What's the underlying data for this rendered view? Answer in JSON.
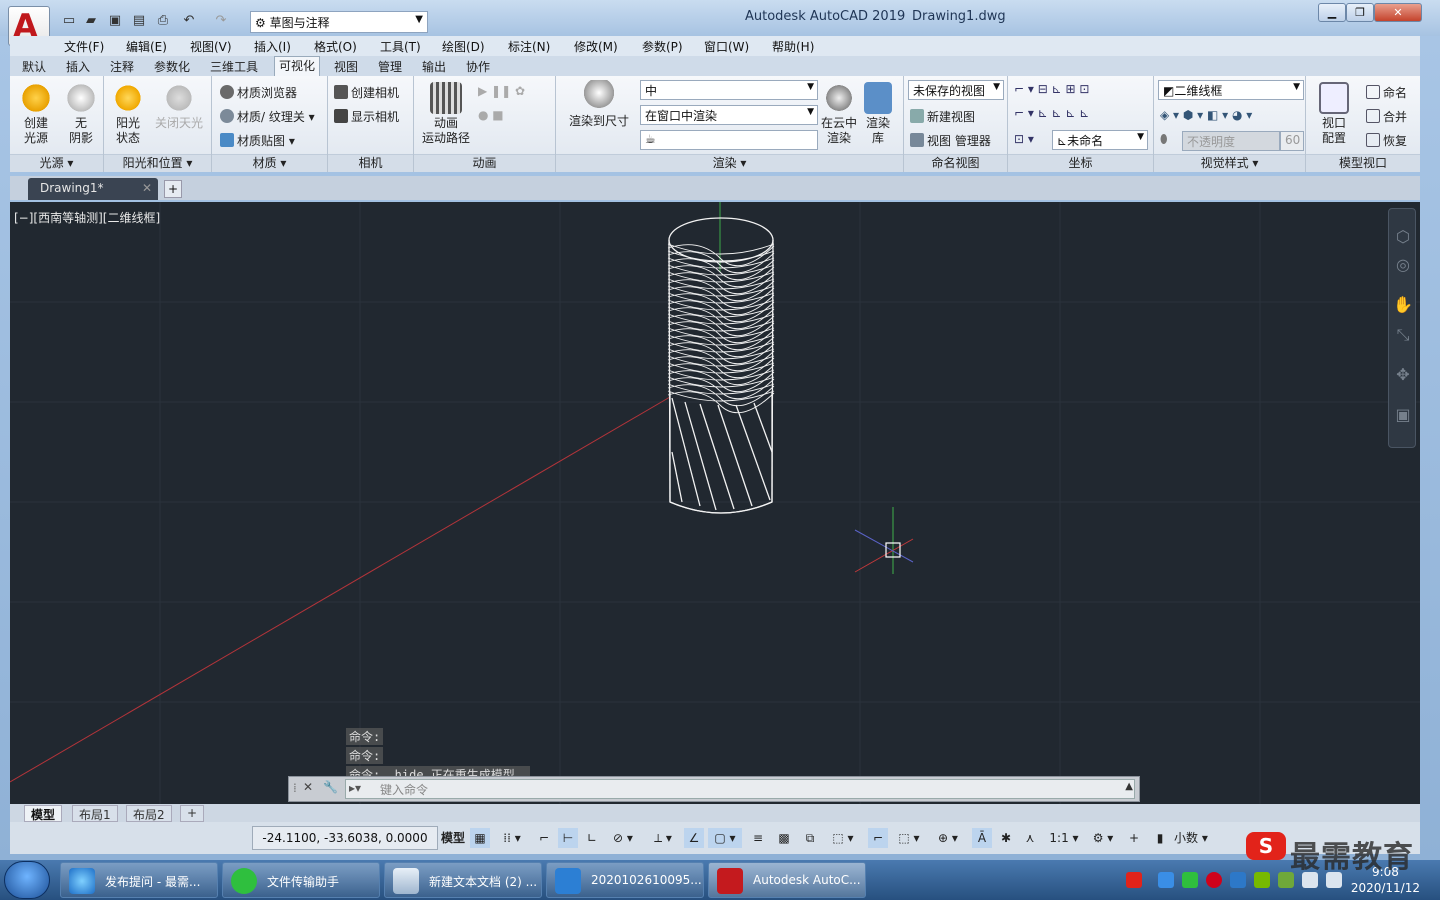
{
  "app": {
    "title": "Autodesk AutoCAD 2019",
    "document": "Drawing1.dwg",
    "workspace": "草图与注释",
    "menu_symbol": "A"
  },
  "menus": [
    "文件(F)",
    "编辑(E)",
    "视图(V)",
    "插入(I)",
    "格式(O)",
    "工具(T)",
    "绘图(D)",
    "标注(N)",
    "修改(M)",
    "参数(P)",
    "窗口(W)",
    "帮助(H)"
  ],
  "ribbon_tabs": [
    "默认",
    "插入",
    "注释",
    "参数化",
    "三维工具",
    "可视化",
    "视图",
    "管理",
    "输出",
    "协作"
  ],
  "active_tab": "可视化",
  "ribbon": {
    "lights": {
      "create_light": "创建\n光源",
      "no_shadow": "无\n阴影",
      "title": "光源"
    },
    "sun": {
      "sun_status": "阳光\n状态",
      "off_sky": "关闭天光",
      "title": "阳光和位置"
    },
    "materials": {
      "browser": "材质浏览器",
      "texture": "材质/ 纹理关",
      "mapping": "材质贴图",
      "title": "材质"
    },
    "camera": {
      "create": "创建相机",
      "show": "显示相机",
      "title": "相机"
    },
    "animation": {
      "motion_path": "动画\n运动路径",
      "title": "动画"
    },
    "render": {
      "render_size": "渲染到尺寸",
      "quality": "中",
      "target": "在窗口中渲染",
      "cloud": "在云中\n渲染",
      "gallery": "渲染\n库",
      "title": "渲染"
    },
    "named_views": {
      "unsaved": "未保存的视图",
      "new_view": "新建视图",
      "manager": "视图 管理器",
      "title": "命名视图"
    },
    "coordinates": {
      "ucs_name": "未命名",
      "title": "坐标"
    },
    "visual_styles": {
      "style": "二维线框",
      "opacity_label": "不透明度",
      "opacity_value": "60",
      "title": "视觉样式"
    },
    "model_viewports": {
      "config": "视口\n配置",
      "name": "命名",
      "join": "合并",
      "restore": "恢复",
      "title": "模型视口"
    }
  },
  "doc_tab": "Drawing1*",
  "viewport_label": "[−][西南等轴测][二维线框]",
  "command_history": [
    "命令:",
    "命令:",
    "命令: _hide 正在重生成模型。"
  ],
  "command_placeholder": "键入命令",
  "layout_tabs": [
    "模型",
    "布局1",
    "布局2"
  ],
  "status": {
    "coords": "-24.1100, -33.6038, 0.0000",
    "model": "模型",
    "scale": "1:1",
    "units": "小数"
  },
  "taskbar": {
    "items": [
      "发布提问 - 最需...",
      "文件传输助手",
      "新建文本文档 (2) ...",
      "2020102610095...",
      "Autodesk AutoC..."
    ],
    "time": "9:08",
    "date": "2020/11/12"
  },
  "watermark": "最需教育",
  "colors": {
    "viewport_bg": "#212830",
    "wire": "#f2f2f2",
    "axis_x": "#c0393b",
    "axis_y": "#3fb04a",
    "axis_z": "#5b63c8"
  }
}
